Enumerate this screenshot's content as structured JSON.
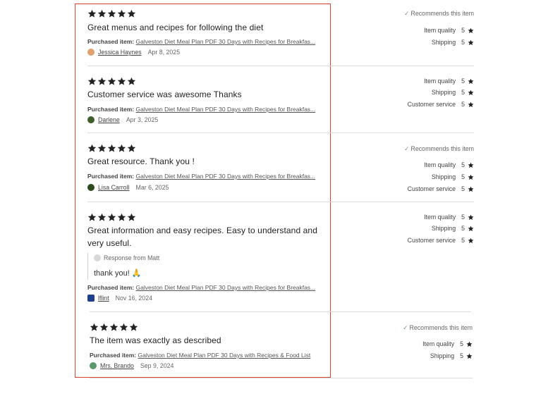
{
  "colors": {
    "highlight": "#d9442c",
    "star": "#222222",
    "divider": "#dddddd"
  },
  "labels": {
    "purchased_label": "Purchased item:",
    "recommends": "Recommends this item"
  },
  "reviews": [
    {
      "stars": 5,
      "text": "Great menus and recipes for following the diet",
      "item": "Galveston Diet Meal Plan PDF 30 Days with Recipes for Breakfas...",
      "author": "Jessica Haynes",
      "date": "Apr 8, 2025",
      "avatar_color": "#e0a070",
      "recommends": true,
      "ratings": [
        {
          "label": "Item quality",
          "value": "5"
        },
        {
          "label": "Shipping",
          "value": "5"
        }
      ]
    },
    {
      "stars": 5,
      "text": "Customer service was awesome Thanks",
      "item": "Galveston Diet Meal Plan PDF 30 Days with Recipes for Breakfas...",
      "author": "Darlene",
      "date": "Apr 3, 2025",
      "avatar_color": "#3f5f2a",
      "recommends": false,
      "ratings": [
        {
          "label": "Item quality",
          "value": "5"
        },
        {
          "label": "Shipping",
          "value": "5"
        },
        {
          "label": "Customer service",
          "value": "5"
        }
      ]
    },
    {
      "stars": 5,
      "text": "Great resource. Thank you !",
      "item": "Galveston Diet Meal Plan PDF 30 Days with Recipes for Breakfas...",
      "author": "Lisa Carroll",
      "date": "Mar 6, 2025",
      "avatar_color": "#2d4a1f",
      "recommends": true,
      "ratings": [
        {
          "label": "Item quality",
          "value": "5"
        },
        {
          "label": "Shipping",
          "value": "5"
        },
        {
          "label": "Customer service",
          "value": "5"
        }
      ]
    },
    {
      "stars": 5,
      "text": "Great information and easy recipes. Easy to understand and very useful.",
      "response_from": "Response from Matt",
      "response_text": "thank you! 🙏",
      "item": "Galveston Diet Meal Plan PDF 30 Days with Recipes for Breakfas...",
      "author": "lflint",
      "date": "Nov 16, 2024",
      "avatar_color": "#1f3f8a",
      "recommends": false,
      "ratings": [
        {
          "label": "Item quality",
          "value": "5"
        },
        {
          "label": "Shipping",
          "value": "5"
        },
        {
          "label": "Customer service",
          "value": "5"
        }
      ]
    },
    {
      "stars": 5,
      "text": "The item was exactly as described",
      "item": "Galveston Diet Meal Plan PDF 30 Days with Recipes & Food List",
      "author": "Mrs. Brando",
      "date": "Sep 9, 2024",
      "avatar_color": "#5a9a6a",
      "recommends": true,
      "ratings": [
        {
          "label": "Item quality",
          "value": "5"
        },
        {
          "label": "Shipping",
          "value": "5"
        }
      ]
    }
  ]
}
